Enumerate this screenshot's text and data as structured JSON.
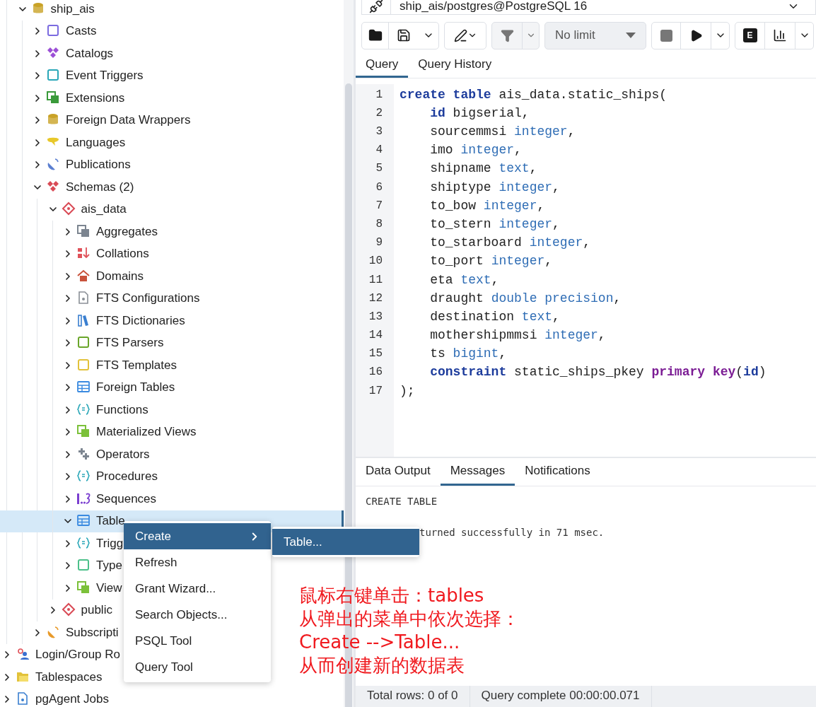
{
  "tree": [
    {
      "kind": "continued",
      "children": [
        {
          "label": "ship_ais",
          "kind": "database",
          "expanded": true,
          "selected": false,
          "children": [
            {
              "label": "Casts",
              "kind": "cast",
              "expanded": false,
              "selected": false
            },
            {
              "label": "Catalogs",
              "kind": "catalog",
              "expanded": false,
              "selected": false
            },
            {
              "label": "Event Triggers",
              "kind": "event_trigger",
              "expanded": false,
              "selected": false
            },
            {
              "label": "Extensions",
              "kind": "extension",
              "expanded": false,
              "selected": false
            },
            {
              "label": "Foreign Data Wrappers",
              "kind": "fdw",
              "expanded": false,
              "selected": false
            },
            {
              "label": "Languages",
              "kind": "language",
              "expanded": false,
              "selected": false
            },
            {
              "label": "Publications",
              "kind": "publication",
              "expanded": false,
              "selected": false
            },
            {
              "label": "Schemas (2)",
              "kind": "schemas",
              "expanded": true,
              "selected": false,
              "children": [
                {
                  "label": "ais_data",
                  "kind": "schema",
                  "expanded": true,
                  "selected": false,
                  "children": [
                    {
                      "label": "Aggregates",
                      "kind": "aggregate",
                      "expanded": false,
                      "selected": false
                    },
                    {
                      "label": "Collations",
                      "kind": "collation",
                      "expanded": false,
                      "selected": false
                    },
                    {
                      "label": "Domains",
                      "kind": "domain",
                      "expanded": false,
                      "selected": false
                    },
                    {
                      "label": "FTS Configurations",
                      "kind": "fts_config",
                      "expanded": false,
                      "selected": false
                    },
                    {
                      "label": "FTS Dictionaries",
                      "kind": "fts_dict",
                      "expanded": false,
                      "selected": false
                    },
                    {
                      "label": "FTS Parsers",
                      "kind": "fts_parser",
                      "expanded": false,
                      "selected": false
                    },
                    {
                      "label": "FTS Templates",
                      "kind": "fts_template",
                      "expanded": false,
                      "selected": false
                    },
                    {
                      "label": "Foreign Tables",
                      "kind": "foreign_table",
                      "expanded": false,
                      "selected": false
                    },
                    {
                      "label": "Functions",
                      "kind": "function",
                      "expanded": false,
                      "selected": false
                    },
                    {
                      "label": "Materialized Views",
                      "kind": "matview",
                      "expanded": false,
                      "selected": false
                    },
                    {
                      "label": "Operators",
                      "kind": "operator",
                      "expanded": false,
                      "selected": false
                    },
                    {
                      "label": "Procedures",
                      "kind": "procedure",
                      "expanded": false,
                      "selected": false
                    },
                    {
                      "label": "Sequences",
                      "kind": "sequence",
                      "expanded": false,
                      "selected": false
                    },
                    {
                      "label": "Table",
                      "kind": "table",
                      "expanded": true,
                      "selected": true
                    },
                    {
                      "label": "Trigg",
                      "kind": "trigger",
                      "expanded": false,
                      "selected": false
                    },
                    {
                      "label": "Type",
                      "kind": "type",
                      "expanded": false,
                      "selected": false
                    },
                    {
                      "label": "View",
                      "kind": "view",
                      "expanded": false,
                      "selected": false
                    }
                  ]
                },
                {
                  "label": "public",
                  "kind": "schema",
                  "expanded": false,
                  "selected": false
                }
              ]
            },
            {
              "label": "Subscripti",
              "kind": "subscription",
              "expanded": false,
              "selected": false
            }
          ]
        }
      ]
    },
    {
      "label": "Login/Group Ro",
      "kind": "roles",
      "expanded": false,
      "selected": false
    },
    {
      "label": "Tablespaces",
      "kind": "tablespace",
      "expanded": false,
      "selected": false
    },
    {
      "label": "pgAgent Jobs",
      "kind": "pgagent",
      "expanded": false,
      "selected": false
    }
  ],
  "connection": {
    "label": "ship_ais/postgres@PostgreSQL 16"
  },
  "toolbar": {
    "row_limit": "No limit",
    "explain_label": "E"
  },
  "editor_tabs": [
    {
      "label": "Query",
      "selected": true
    },
    {
      "label": "Query History",
      "selected": false
    }
  ],
  "editor": {
    "lines": [
      {
        "number": "1",
        "tokens": [
          {
            "text": "create table",
            "kind": "keyword"
          },
          {
            "text": " ais_data.static_ships(",
            "kind": "plain"
          }
        ]
      },
      {
        "number": "2",
        "indented": true,
        "tokens": [
          {
            "text": "id",
            "kind": "keyword"
          },
          {
            "text": " bigserial,",
            "kind": "plain"
          }
        ]
      },
      {
        "number": "3",
        "indented": true,
        "tokens": [
          {
            "text": "sourcemmsi ",
            "kind": "plain"
          },
          {
            "text": "integer",
            "kind": "type"
          },
          {
            "text": ",",
            "kind": "plain"
          }
        ]
      },
      {
        "number": "4",
        "indented": true,
        "tokens": [
          {
            "text": "imo ",
            "kind": "plain"
          },
          {
            "text": "integer",
            "kind": "type"
          },
          {
            "text": ",",
            "kind": "plain"
          }
        ]
      },
      {
        "number": "5",
        "indented": true,
        "tokens": [
          {
            "text": "shipname ",
            "kind": "plain"
          },
          {
            "text": "text",
            "kind": "type"
          },
          {
            "text": ",",
            "kind": "plain"
          }
        ]
      },
      {
        "number": "6",
        "indented": true,
        "tokens": [
          {
            "text": "shiptype ",
            "kind": "plain"
          },
          {
            "text": "integer",
            "kind": "type"
          },
          {
            "text": ",",
            "kind": "plain"
          }
        ]
      },
      {
        "number": "7",
        "indented": true,
        "tokens": [
          {
            "text": "to_bow ",
            "kind": "plain"
          },
          {
            "text": "integer",
            "kind": "type"
          },
          {
            "text": ",",
            "kind": "plain"
          }
        ]
      },
      {
        "number": "8",
        "indented": true,
        "tokens": [
          {
            "text": "to_stern ",
            "kind": "plain"
          },
          {
            "text": "integer",
            "kind": "type"
          },
          {
            "text": ",",
            "kind": "plain"
          }
        ]
      },
      {
        "number": "9",
        "indented": true,
        "tokens": [
          {
            "text": "to_starboard ",
            "kind": "plain"
          },
          {
            "text": "integer",
            "kind": "type"
          },
          {
            "text": ",",
            "kind": "plain"
          }
        ]
      },
      {
        "number": "10",
        "indented": true,
        "tokens": [
          {
            "text": "to_port ",
            "kind": "plain"
          },
          {
            "text": "integer",
            "kind": "type"
          },
          {
            "text": ",",
            "kind": "plain"
          }
        ]
      },
      {
        "number": "11",
        "indented": true,
        "tokens": [
          {
            "text": "eta ",
            "kind": "plain"
          },
          {
            "text": "text",
            "kind": "type"
          },
          {
            "text": ",",
            "kind": "plain"
          }
        ]
      },
      {
        "number": "12",
        "indented": true,
        "tokens": [
          {
            "text": "draught ",
            "kind": "plain"
          },
          {
            "text": "double precision",
            "kind": "type"
          },
          {
            "text": ",",
            "kind": "plain"
          }
        ]
      },
      {
        "number": "13",
        "indented": true,
        "tokens": [
          {
            "text": "destination ",
            "kind": "plain"
          },
          {
            "text": "text",
            "kind": "type"
          },
          {
            "text": ",",
            "kind": "plain"
          }
        ]
      },
      {
        "number": "14",
        "indented": true,
        "tokens": [
          {
            "text": "mothershipmmsi ",
            "kind": "plain"
          },
          {
            "text": "integer",
            "kind": "type"
          },
          {
            "text": ",",
            "kind": "plain"
          }
        ]
      },
      {
        "number": "15",
        "indented": true,
        "tokens": [
          {
            "text": "ts ",
            "kind": "plain"
          },
          {
            "text": "bigint",
            "kind": "type"
          },
          {
            "text": ",",
            "kind": "plain"
          }
        ]
      },
      {
        "number": "16",
        "indented": true,
        "tokens": [
          {
            "text": "constraint",
            "kind": "keyword"
          },
          {
            "text": " static_ships_pkey ",
            "kind": "plain"
          },
          {
            "text": "primary key",
            "kind": "special"
          },
          {
            "text": "(",
            "kind": "plain"
          },
          {
            "text": "id",
            "kind": "keyword"
          },
          {
            "text": ")",
            "kind": "plain"
          }
        ]
      },
      {
        "number": "17",
        "tokens": [
          {
            "text": ");",
            "kind": "plain"
          }
        ]
      }
    ]
  },
  "result_tabs": [
    {
      "label": "Data Output",
      "selected": false
    },
    {
      "label": "Messages",
      "selected": true
    },
    {
      "label": "Notifications",
      "selected": false
    }
  ],
  "messages": [
    {
      "text": "CREATE TABLE",
      "kind": "plain"
    },
    {
      "text": "turned successfully in 71 msec.",
      "kind": "covered"
    }
  ],
  "status_bar": [
    "Total rows: 0 of 0",
    "Query complete 00:00:00.071"
  ],
  "context_menu": {
    "items": [
      {
        "label": "Create",
        "selected": true,
        "has_submenu": true
      },
      {
        "label": "Refresh",
        "selected": false,
        "has_submenu": false
      },
      {
        "label": "Grant Wizard...",
        "selected": false,
        "has_submenu": false
      },
      {
        "label": "Search Objects...",
        "selected": false,
        "has_submenu": false
      },
      {
        "label": "PSQL Tool",
        "selected": false,
        "has_submenu": false
      },
      {
        "label": "Query Tool",
        "selected": false,
        "has_submenu": false
      }
    ]
  },
  "submenu": {
    "items": [
      {
        "label": "Table...",
        "selected": true
      }
    ]
  },
  "annotation": [
    "鼠标右键单击：tables",
    "从弹出的菜单中依次选择：",
    "Create -->Table...",
    "从而创建新的数据表"
  ]
}
